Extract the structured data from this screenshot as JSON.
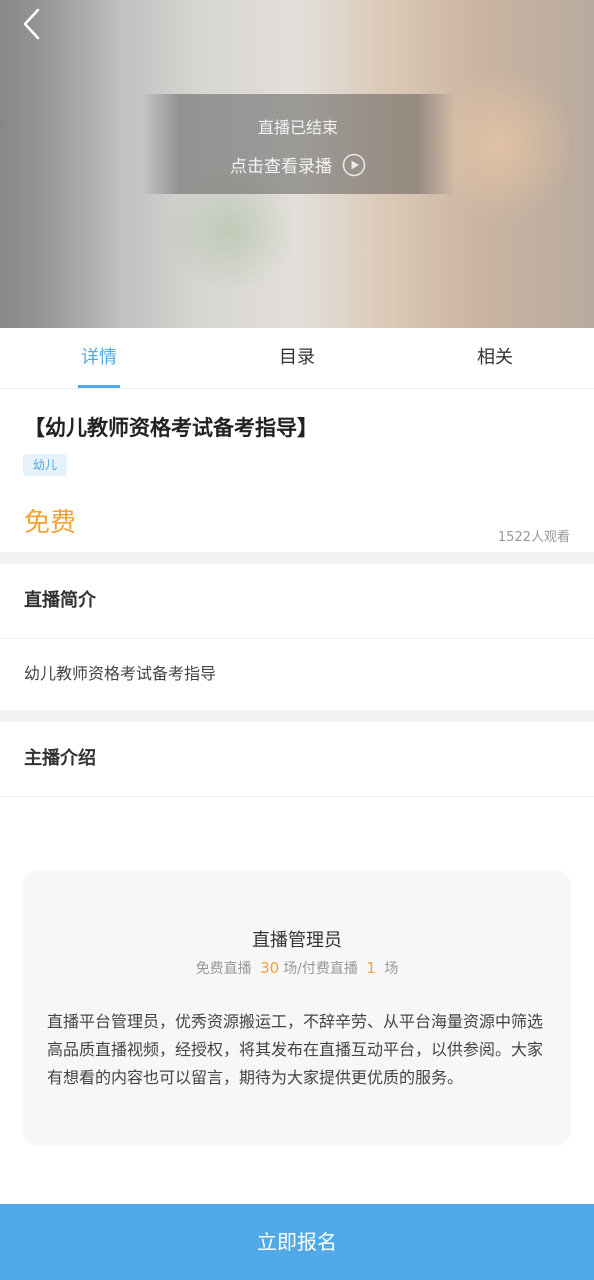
{
  "hero": {
    "live_status": "直播已结束",
    "replay_label": "点击查看录播"
  },
  "icons": {
    "back": "chevron-left-icon",
    "play": "play-circle-icon"
  },
  "tabs": [
    {
      "label": "详情",
      "active": true
    },
    {
      "label": "目录",
      "active": false
    },
    {
      "label": "相关",
      "active": false
    }
  ],
  "course": {
    "title": "【幼儿教师资格考试备考指导】",
    "tag": "幼儿",
    "price": "免费",
    "viewers": "1522人观看"
  },
  "intro": {
    "heading": "直播简介",
    "text": "幼儿教师资格考试备考指导"
  },
  "host": {
    "heading": "主播介绍",
    "name": "直播管理员",
    "free_label": "免费直播",
    "free_count": "30",
    "free_unit": "场/付费直播",
    "paid_count": "1",
    "paid_unit": "场",
    "description": "直播平台管理员，优秀资源搬运工，不辞辛劳、从平台海量资源中筛选高品质直播视频，经授权，将其发布在直播互动平台，以供参阅。大家有想看的内容也可以留言，期待为大家提供更优质的服务。"
  },
  "actions": {
    "signup": "立即报名"
  },
  "colors": {
    "accent": "#4fa9e6",
    "price": "#f5a233",
    "button": "#52a9e8"
  }
}
